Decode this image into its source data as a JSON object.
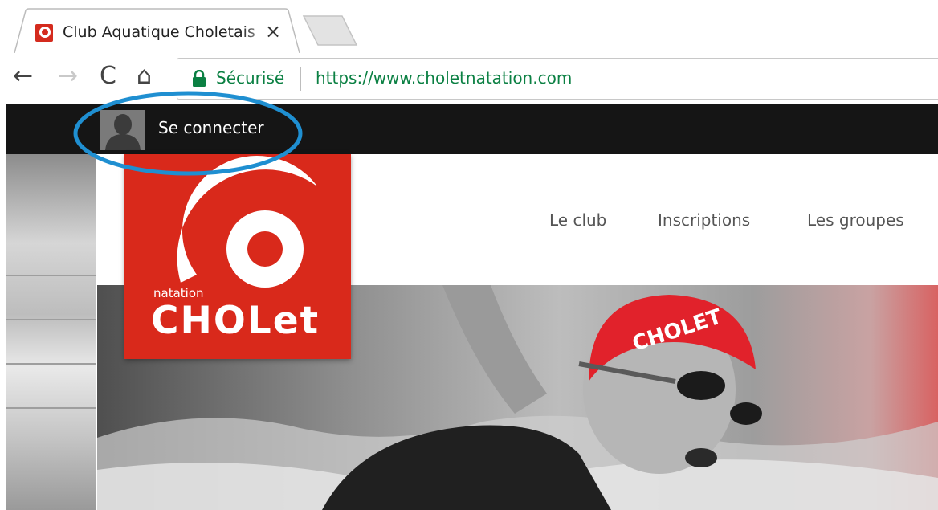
{
  "browser": {
    "tab_title": "Club Aquatique Choletais",
    "tab_close": "×",
    "nav": {
      "back": "←",
      "forward": "→",
      "reload": "C",
      "home": "⌂"
    },
    "secure_label": "Sécurisé",
    "url": "https://www.choletnatation.com"
  },
  "site": {
    "signin_label": "Se connecter",
    "menu": [
      "Le club",
      "Inscriptions",
      "Les groupes"
    ],
    "logo": {
      "small": "natation",
      "big": "CHOLet"
    },
    "hero_cap_text": "CHOLET"
  },
  "colors": {
    "brand_red": "#d9291b",
    "topbar": "#151515",
    "secure_green": "#0b8043",
    "annotation_blue": "#1f8fd1"
  },
  "icons": [
    "favicon-icon",
    "close-icon",
    "back-icon",
    "forward-icon",
    "reload-icon",
    "home-icon",
    "lock-icon",
    "user-avatar-icon"
  ]
}
